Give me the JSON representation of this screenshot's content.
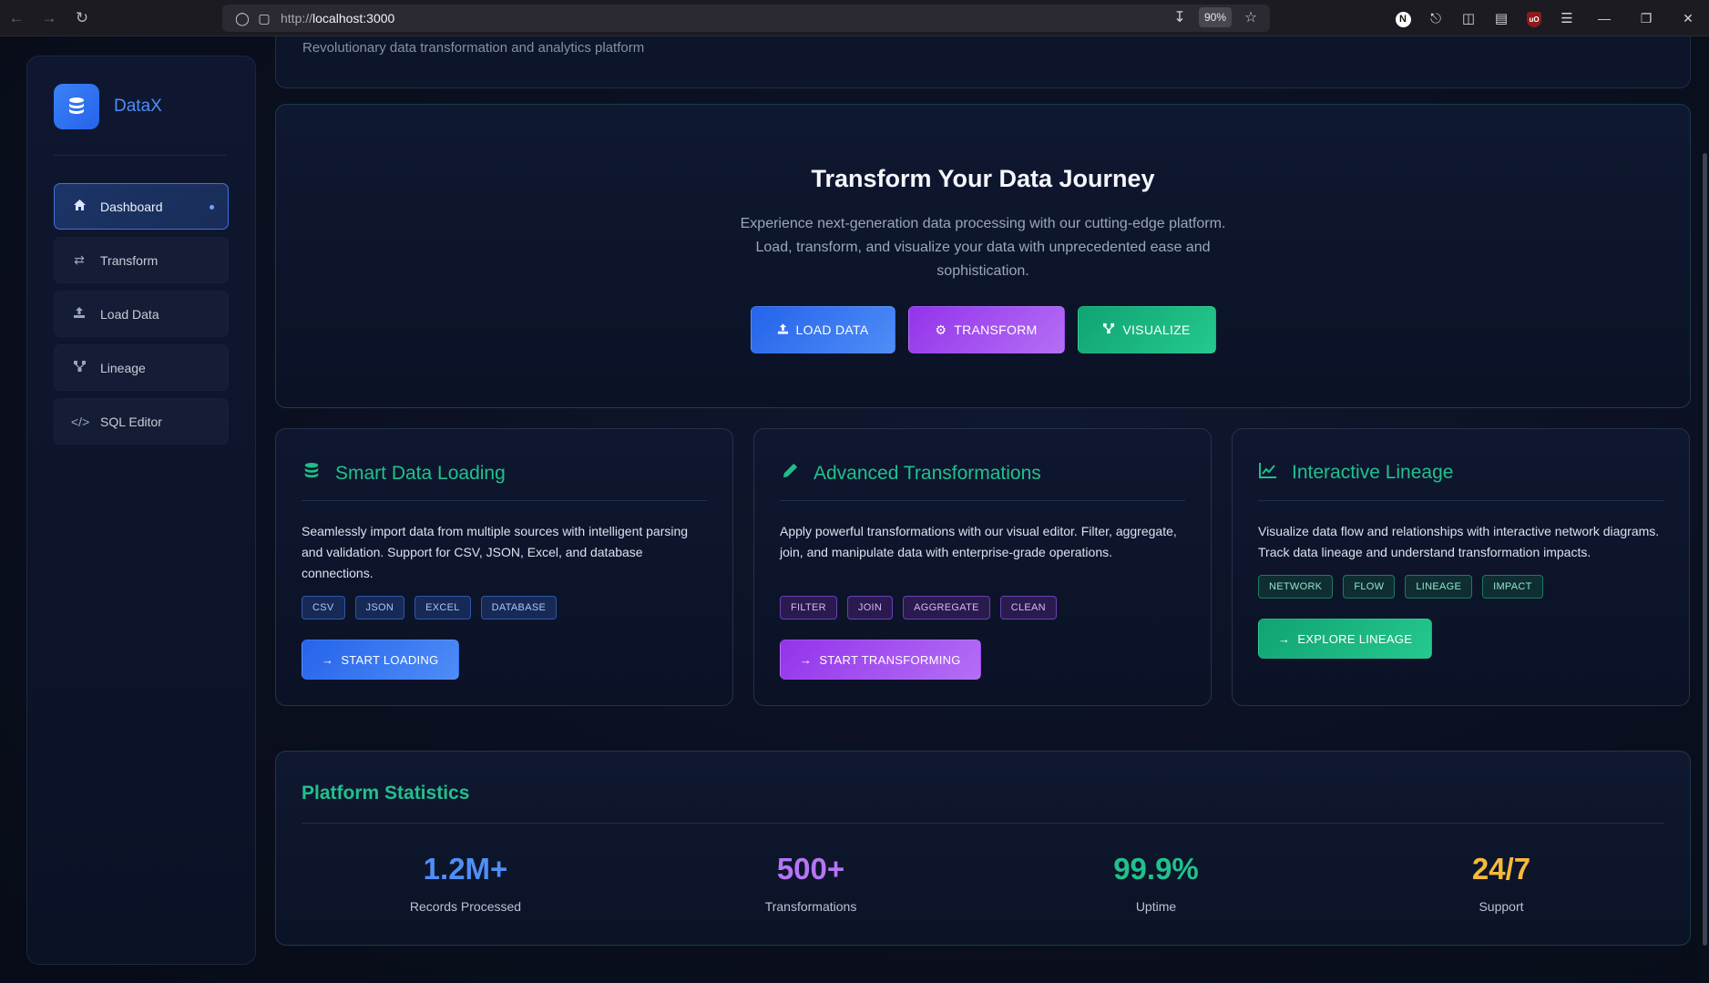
{
  "browser": {
    "url_prefix": "http://",
    "url_host": "localhost:3000",
    "zoom": "90%"
  },
  "sidebar": {
    "brand": "DataX",
    "items": [
      {
        "label": "Dashboard",
        "icon": "home-icon",
        "active": true
      },
      {
        "label": "Transform",
        "icon": "exchange-icon"
      },
      {
        "label": "Load Data",
        "icon": "upload-icon"
      },
      {
        "label": "Lineage",
        "icon": "network-icon"
      },
      {
        "label": "SQL Editor",
        "icon": "code-icon"
      }
    ]
  },
  "top_card": {
    "subtitle": "Revolutionary data transformation and analytics platform"
  },
  "hero": {
    "title": "Transform Your Data Journey",
    "text": "Experience next-generation data processing with our cutting-edge platform. Load, transform, and visualize your data with unprecedented ease and sophistication.",
    "buttons": [
      "LOAD DATA",
      "TRANSFORM",
      "VISUALIZE"
    ]
  },
  "features": [
    {
      "title": "Smart Data Loading",
      "icon": "database-icon",
      "text": "Seamlessly import data from multiple sources with intelligent parsing and validation. Support for CSV, JSON, Excel, and database connections.",
      "tags": [
        "CSV",
        "JSON",
        "EXCEL",
        "DATABASE"
      ],
      "button": "START LOADING"
    },
    {
      "title": "Advanced Transformations",
      "icon": "pencil-icon",
      "text": "Apply powerful transformations with our visual editor. Filter, aggregate, join, and manipulate data with enterprise-grade operations.",
      "tags": [
        "FILTER",
        "JOIN",
        "AGGREGATE",
        "CLEAN"
      ],
      "button": "START TRANSFORMING"
    },
    {
      "title": "Interactive Lineage",
      "icon": "line-chart-icon",
      "text": "Visualize data flow and relationships with interactive network diagrams. Track data lineage and understand transformation impacts.",
      "tags": [
        "NETWORK",
        "FLOW",
        "LINEAGE",
        "IMPACT"
      ],
      "button": "EXPLORE LINEAGE"
    }
  ],
  "stats": {
    "title": "Platform Statistics",
    "items": [
      {
        "value": "1.2M+",
        "label": "Records Processed",
        "color": "#4f8ff7"
      },
      {
        "value": "500+",
        "label": "Transformations",
        "color": "#b575f5"
      },
      {
        "value": "99.9%",
        "label": "Uptime",
        "color": "#22c08c"
      },
      {
        "value": "24/7",
        "label": "Support",
        "color": "#f6b93b"
      }
    ]
  },
  "colors": {
    "accent_blue": "#3b82f6",
    "accent_purple": "#9333ea",
    "accent_green": "#10b981"
  }
}
